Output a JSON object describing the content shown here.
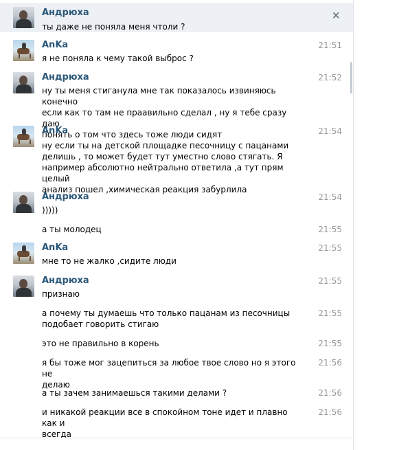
{
  "names": {
    "andr": "Андрюха",
    "anka": "AnKa"
  },
  "messages": [
    {
      "text": "ты даже не поняла меня чтоли ?"
    },
    {
      "time": "21:51",
      "text": "я не поняла к чему такой выброс ?"
    },
    {
      "time": "21:52",
      "text": "ну ты меня стиганула мне так показалось извиняюсь конечно\nесли как то там не праавильно сделал , ну я тебе сразу даю\nпонять о том что здесь тоже люди сидят"
    },
    {
      "time": "21:54",
      "text": "ну если ты на детской площадке песочницу с пацанами\nделишь , то может будет тут уместно слово стягать. Я\nнапример абсолютно нейтрально ответила ,а тут прям целый\nанализ пошел ,химическая реакция забурлила"
    },
    {
      "time": "21:54",
      "text": ")))))"
    },
    {
      "time": "21:55",
      "text": "а ты молодец"
    },
    {
      "time": "21:55",
      "text": "мне то не жалко ,сидите люди"
    },
    {
      "time": "21:55",
      "text": "признаю"
    },
    {
      "time": "21:55",
      "text": "а почему ты думаешь что только пацанам из песочницы\nподобает говорить стигаю"
    },
    {
      "time": "21:55",
      "text": "это не правильно в корень"
    },
    {
      "time": "21:56",
      "text": "я бы тоже мог зацепиться за любое твое слово но я этого не\nделаю"
    },
    {
      "time": "21:56",
      "text": "а ты зачем занимаешься такими делами ?"
    },
    {
      "time": "21:56",
      "text": "и никакой реакции все в спокойном тоне идет и плавно как и\nвсегда"
    }
  ],
  "icons": {
    "close": "close-icon",
    "andr_avatar": "user-photo-andryukha",
    "anka_avatar": "user-photo-horse-rider"
  },
  "colors": {
    "name": "#2b587a",
    "time": "#999999",
    "highlight": "#edf1f5"
  }
}
